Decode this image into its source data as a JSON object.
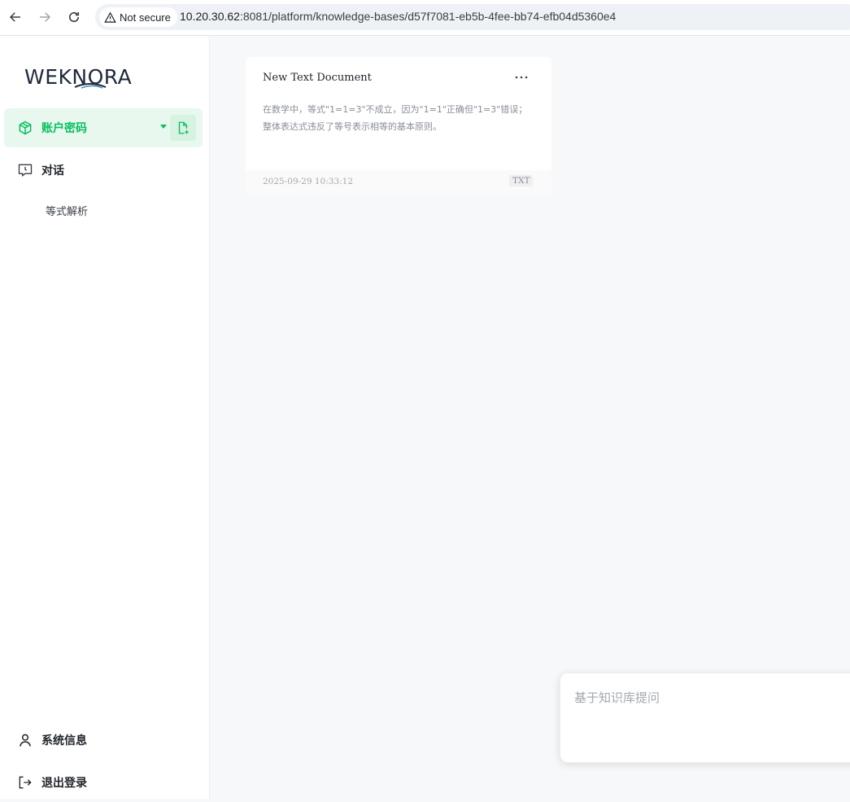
{
  "browser": {
    "security_label": "Not secure",
    "url_host": "10.20.30.62",
    "url_path": ":8081/platform/knowledge-bases/d57f7081-eb5b-4fee-bb74-efb04d5360e4",
    "icons": [
      "back-arrow-icon",
      "forward-arrow-icon",
      "reload-icon",
      "warning-triangle-icon"
    ]
  },
  "sidebar": {
    "logo_text": "WEKNORA",
    "items": [
      {
        "label": "账户密码",
        "icon": "knowledge-box-icon",
        "active": true
      },
      {
        "label": "对话",
        "icon": "chat-clock-icon",
        "active": false
      }
    ],
    "conversations": [
      {
        "label": "等式解析"
      }
    ],
    "bottom_items": [
      {
        "label": "系统信息",
        "icon": "user-icon"
      },
      {
        "label": "退出登录",
        "icon": "logout-icon"
      }
    ]
  },
  "documents": [
    {
      "title": "New Text Document",
      "excerpt": "在数学中，等式\"1=1=3\"不成立，因为\"1=1\"正确但\"1=3\"错误；整体表达式违反了等号表示相等的基本原则。",
      "date": "2025-09-29 10:33:12",
      "type": "TXT"
    }
  ],
  "ask": {
    "placeholder": "基于知识库提问"
  },
  "colors": {
    "accent": "#07c05f",
    "accent_bg": "#e8f8ee",
    "main_bg": "#f7f8fa"
  }
}
